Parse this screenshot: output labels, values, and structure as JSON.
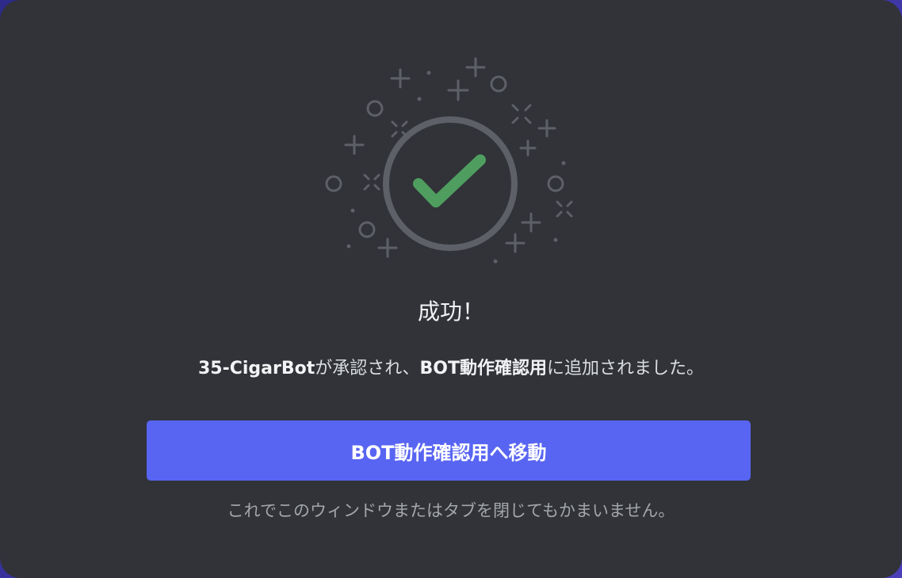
{
  "success": {
    "title": "成功！",
    "message": {
      "bot_name": "35-CigarBot",
      "part1": "が承認され、",
      "server_name": "BOT動作確認用",
      "part2": "に追加されました。"
    },
    "button_label": "BOT動作確認用へ移動",
    "hint": "これでこのウィンドウまたはタブを閉じてもかまいません。"
  },
  "colors": {
    "modal_bg": "#313338",
    "accent": "#5865f2",
    "success_check": "#4f9e5f",
    "decoration": "#5e6068"
  },
  "icons": {
    "success": "checkmark-circle-icon",
    "decoration": "sparkle-icon"
  }
}
